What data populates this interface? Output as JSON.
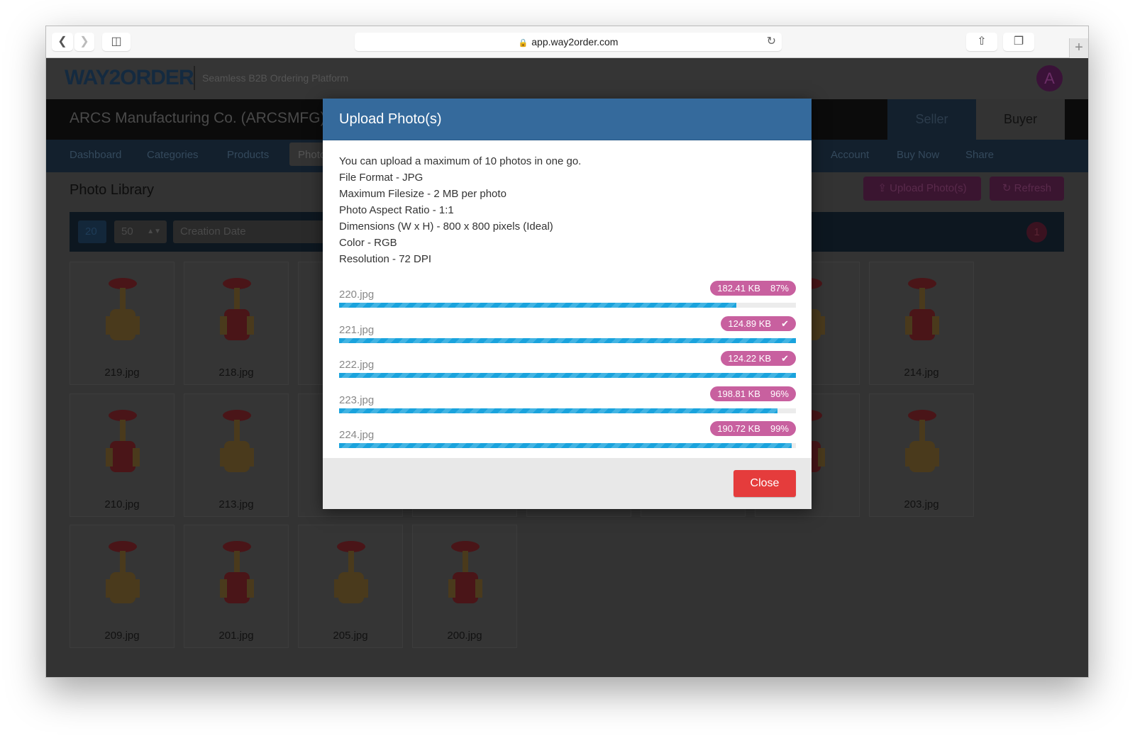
{
  "browser": {
    "url": "app.way2order.com"
  },
  "header": {
    "logo": "WAY2ORDER",
    "tagline": "Seamless B2B Ordering Platform",
    "avatar": "A"
  },
  "company": {
    "name": "ARCS Manufacturing Co. (ARCSMFG)",
    "roles": [
      "Seller",
      "Buyer"
    ]
  },
  "nav": {
    "items": [
      "Dashboard",
      "Categories",
      "Products",
      "Photos",
      "Account",
      "Buy Now",
      "Share"
    ]
  },
  "page": {
    "title": "Photo Library",
    "upload_label": "Upload Photo(s)",
    "refresh_label": "Refresh"
  },
  "filter": {
    "count": "20",
    "per_page": "50",
    "sort": "Creation Date",
    "badge": "1"
  },
  "grid": [
    [
      "219.jpg",
      "218.jpg",
      "",
      "",
      "",
      "",
      "",
      "214.jpg"
    ],
    [
      "210.jpg",
      "213.jpg",
      "",
      "",
      "",
      "",
      "",
      "203.jpg"
    ],
    [
      "209.jpg",
      "201.jpg",
      "205.jpg",
      "200.jpg"
    ]
  ],
  "modal": {
    "title": "Upload Photo(s)",
    "info": [
      "You can upload a maximum of 10 photos in one go.",
      "File Format - JPG",
      "Maximum Filesize - 2 MB per photo",
      "Photo Aspect Ratio - 1:1",
      "Dimensions (W x H) - 800 x 800 pixels (Ideal)",
      "Color - RGB",
      "Resolution - 72 DPI"
    ],
    "files": [
      {
        "name": "220.jpg",
        "size": "182.41 KB",
        "status": "87%",
        "progress": 87
      },
      {
        "name": "221.jpg",
        "size": "124.89 KB",
        "status": "done",
        "progress": 100
      },
      {
        "name": "222.jpg",
        "size": "124.22 KB",
        "status": "done",
        "progress": 100
      },
      {
        "name": "223.jpg",
        "size": "198.81 KB",
        "status": "96%",
        "progress": 96
      },
      {
        "name": "224.jpg",
        "size": "190.72 KB",
        "status": "99%",
        "progress": 99
      }
    ],
    "close_label": "Close"
  },
  "colors": {
    "modal_header": "#356a9c",
    "badge": "#c8609f",
    "progress": "#1aa3dd",
    "close": "#e53c3c"
  }
}
